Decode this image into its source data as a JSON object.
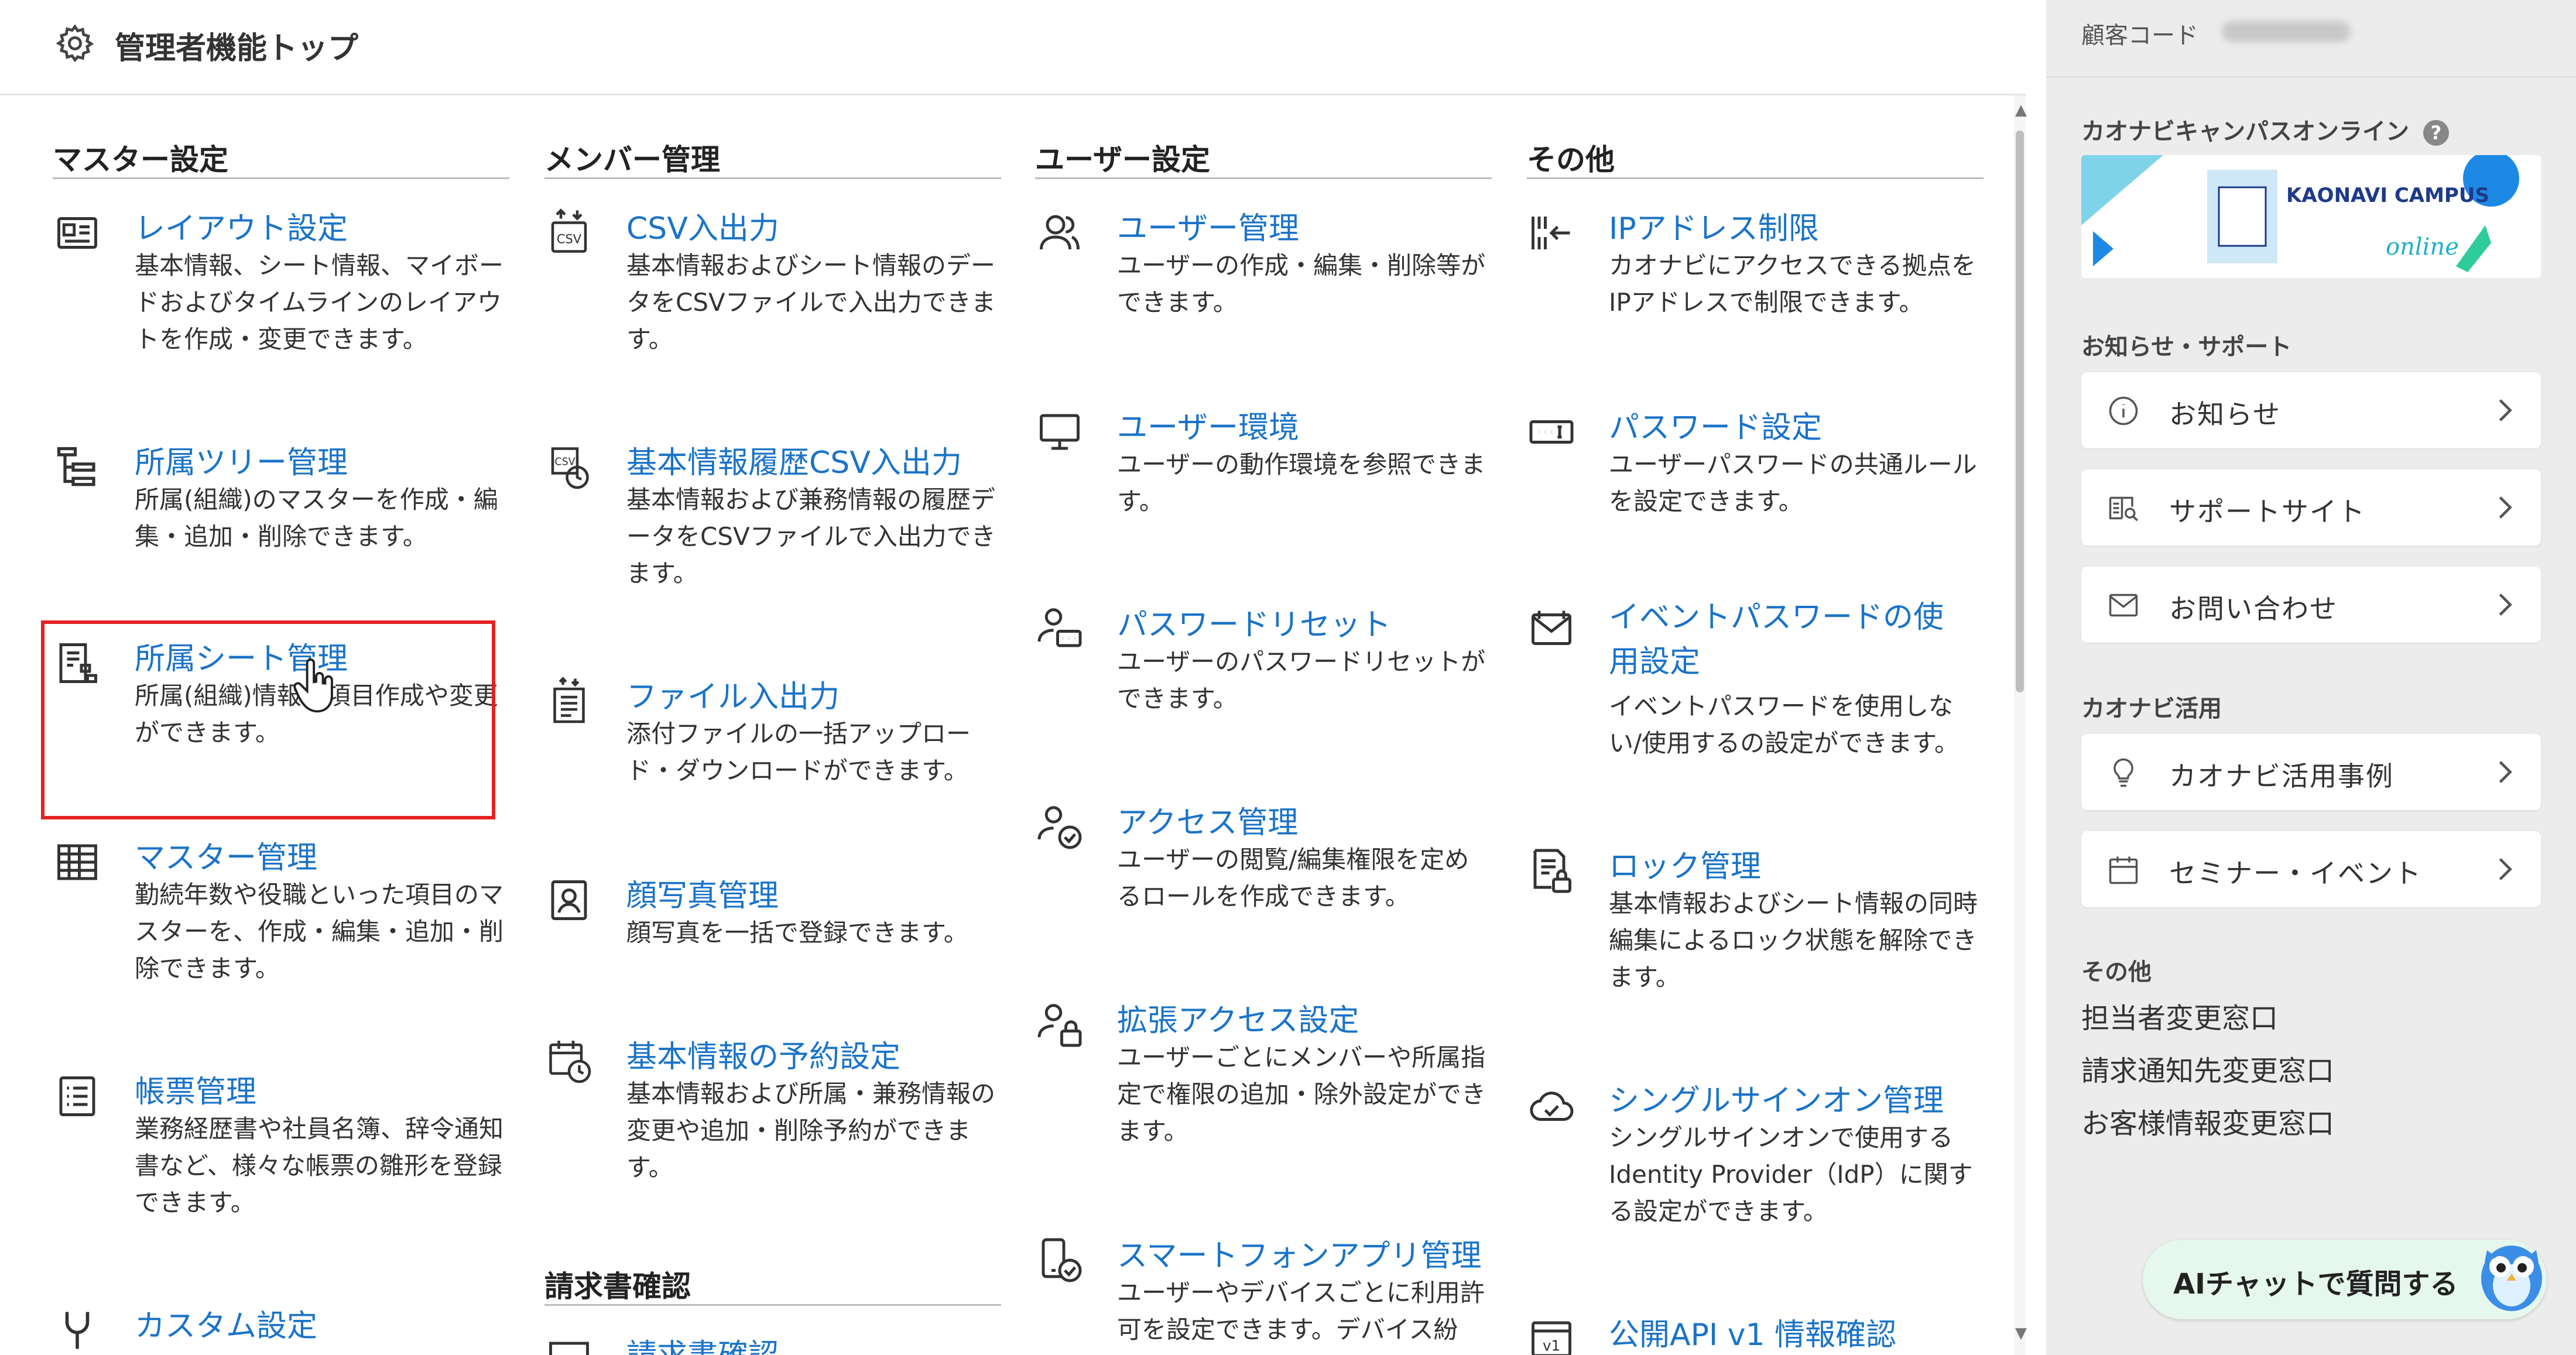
{
  "header": {
    "title": "管理者機能トップ"
  },
  "columns": [
    {
      "heading": "マスター設定",
      "items": [
        {
          "title": "レイアウト設定",
          "desc": "基本情報、シート情報、マイボードおよびタイムラインのレイアウトを作成・変更できます。",
          "icon": "layout-icon"
        },
        {
          "title": "所属ツリー管理",
          "desc": "所属(組織)のマスターを作成・編集・追加・削除できます。",
          "icon": "tree-icon"
        },
        {
          "title": "所属シート管理",
          "desc": "所属(組織)情報の項目作成や変更ができます。",
          "icon": "sheet-icon"
        },
        {
          "title": "マスター管理",
          "desc": "勤続年数や役職といった項目のマスターを、作成・編集・追加・削除できます。",
          "icon": "grid-icon"
        },
        {
          "title": "帳票管理",
          "desc": "業務経歴書や社員名簿、辞令通知書など、様々な帳票の雛形を登録できます。",
          "icon": "list-icon"
        },
        {
          "title": "カスタム設定",
          "desc": "",
          "icon": "wrench-icon"
        }
      ]
    },
    {
      "heading": "メンバー管理",
      "items": [
        {
          "title": "CSV入出力",
          "desc": "基本情報およびシート情報のデータをCSVファイルで入出力できます。",
          "icon": "csv-icon"
        },
        {
          "title": "基本情報履歴CSV入出力",
          "desc": "基本情報および兼務情報の履歴データをCSVファイルで入出力できます。",
          "icon": "csv-history-icon"
        },
        {
          "title": "ファイル入出力",
          "desc": "添付ファイルの一括アップロード・ダウンロードができます。",
          "icon": "file-icon"
        },
        {
          "title": "顔写真管理",
          "desc": "顔写真を一括で登録できます。",
          "icon": "portrait-icon"
        },
        {
          "title": "基本情報の予約設定",
          "desc": "基本情報および所属・兼務情報の変更や追加・削除予約ができます。",
          "icon": "calendar-clock-icon"
        }
      ],
      "heading2": "請求書確認",
      "item2": "請求書確認"
    },
    {
      "heading": "ユーザー設定",
      "items": [
        {
          "title": "ユーザー管理",
          "desc": "ユーザーの作成・編集・削除等ができます。",
          "icon": "users-icon"
        },
        {
          "title": "ユーザー環境",
          "desc": "ユーザーの動作環境を参照できます。",
          "icon": "monitor-icon"
        },
        {
          "title": "パスワードリセット",
          "desc": "ユーザーのパスワードリセットができます。",
          "icon": "user-password-icon"
        },
        {
          "title": "アクセス管理",
          "desc": "ユーザーの閲覧/編集権限を定めるロールを作成できます。",
          "icon": "user-check-icon"
        },
        {
          "title": "拡張アクセス設定",
          "desc": "ユーザーごとにメンバーや所属指定で権限の追加・除外設定ができます。",
          "icon": "user-lock-icon"
        },
        {
          "title": "スマートフォンアプリ管理",
          "desc": "ユーザーやデバイスごとに利用許可を設定できます。デバイス紛",
          "icon": "phone-check-icon"
        }
      ]
    },
    {
      "heading": "その他",
      "items": [
        {
          "title": "IPアドレス制限",
          "desc": "カオナビにアクセスできる拠点をIPアドレスで制限できます。",
          "icon": "ip-icon"
        },
        {
          "title": "パスワード設定",
          "desc": "ユーザーパスワードの共通ルールを設定できます。",
          "icon": "password-icon"
        },
        {
          "title": "イベントパスワードの使用設定",
          "desc": "イベントパスワードを使用しない/使用するの設定ができます。",
          "icon": "event-mail-icon"
        },
        {
          "title": "ロック管理",
          "desc": "基本情報およびシート情報の同時編集によるロック状態を解除できます。",
          "icon": "doc-lock-icon"
        },
        {
          "title": "シングルサインオン管理",
          "desc": "シングルサインオンで使用するIdentity Provider（IdP）に関する設定ができます。",
          "icon": "cloud-check-icon"
        },
        {
          "title": "公開API v1 情報確認",
          "desc": "",
          "icon": "api-v1-icon"
        }
      ]
    }
  ],
  "panel": {
    "customer_label": "顧客コード",
    "campus_label": "カオナビキャンパスオンライン",
    "news_section": "お知らせ・サポート",
    "cards1": [
      {
        "label": "お知らせ",
        "icon": "info-icon"
      },
      {
        "label": "サポートサイト",
        "icon": "book-search-icon"
      },
      {
        "label": "お問い合わせ",
        "icon": "mail-icon"
      }
    ],
    "use_section": "カオナビ活用",
    "cards2": [
      {
        "label": "カオナビ活用事例",
        "icon": "bulb-icon"
      },
      {
        "label": "セミナー・イベント",
        "icon": "calendar-icon"
      }
    ],
    "other_section": "その他",
    "links": [
      "担当者変更窓口",
      "請求通知先変更窓口",
      "お客様情報変更窓口"
    ],
    "banner_text": "KAONAVI CAMPUS",
    "banner_sub": "online"
  },
  "ai_chat": {
    "label": "AIチャットで質問する"
  },
  "colors": {
    "link": "#1a73c8",
    "highlight": "#e32222",
    "panel": "#ececec"
  }
}
